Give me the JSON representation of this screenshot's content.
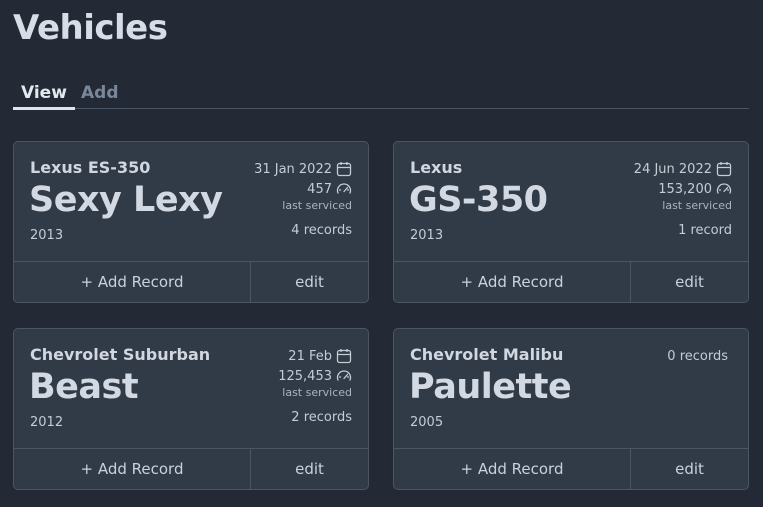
{
  "page_title": "Vehicles",
  "tabs": [
    {
      "label": "View",
      "active": true
    },
    {
      "label": "Add",
      "active": false
    }
  ],
  "vehicles": [
    {
      "make": "Lexus ES-350",
      "nickname": "Sexy Lexy",
      "year": "2013",
      "date": "31 Jan 2022",
      "mileage": "457",
      "last_serviced": "last serviced",
      "records": "4 records",
      "add_label": "+ Add Record",
      "edit_label": "edit"
    },
    {
      "make": "Lexus",
      "nickname": "GS-350",
      "year": "2013",
      "date": "24 Jun 2022",
      "mileage": "153,200",
      "last_serviced": "last serviced",
      "records": "1 record",
      "add_label": "+ Add Record",
      "edit_label": "edit"
    },
    {
      "make": "Chevrolet Suburban",
      "nickname": "Beast",
      "year": "2012",
      "date": "21 Feb",
      "mileage": "125,453",
      "last_serviced": "last serviced",
      "records": "2 records",
      "add_label": "+ Add Record",
      "edit_label": "edit"
    },
    {
      "make": "Chevrolet Malibu",
      "nickname": "Paulette",
      "year": "2005",
      "records": "0 records",
      "add_label": "+ Add Record",
      "edit_label": "edit"
    }
  ],
  "icons": {
    "date": "calendar-icon",
    "mileage": "speedometer-icon"
  }
}
